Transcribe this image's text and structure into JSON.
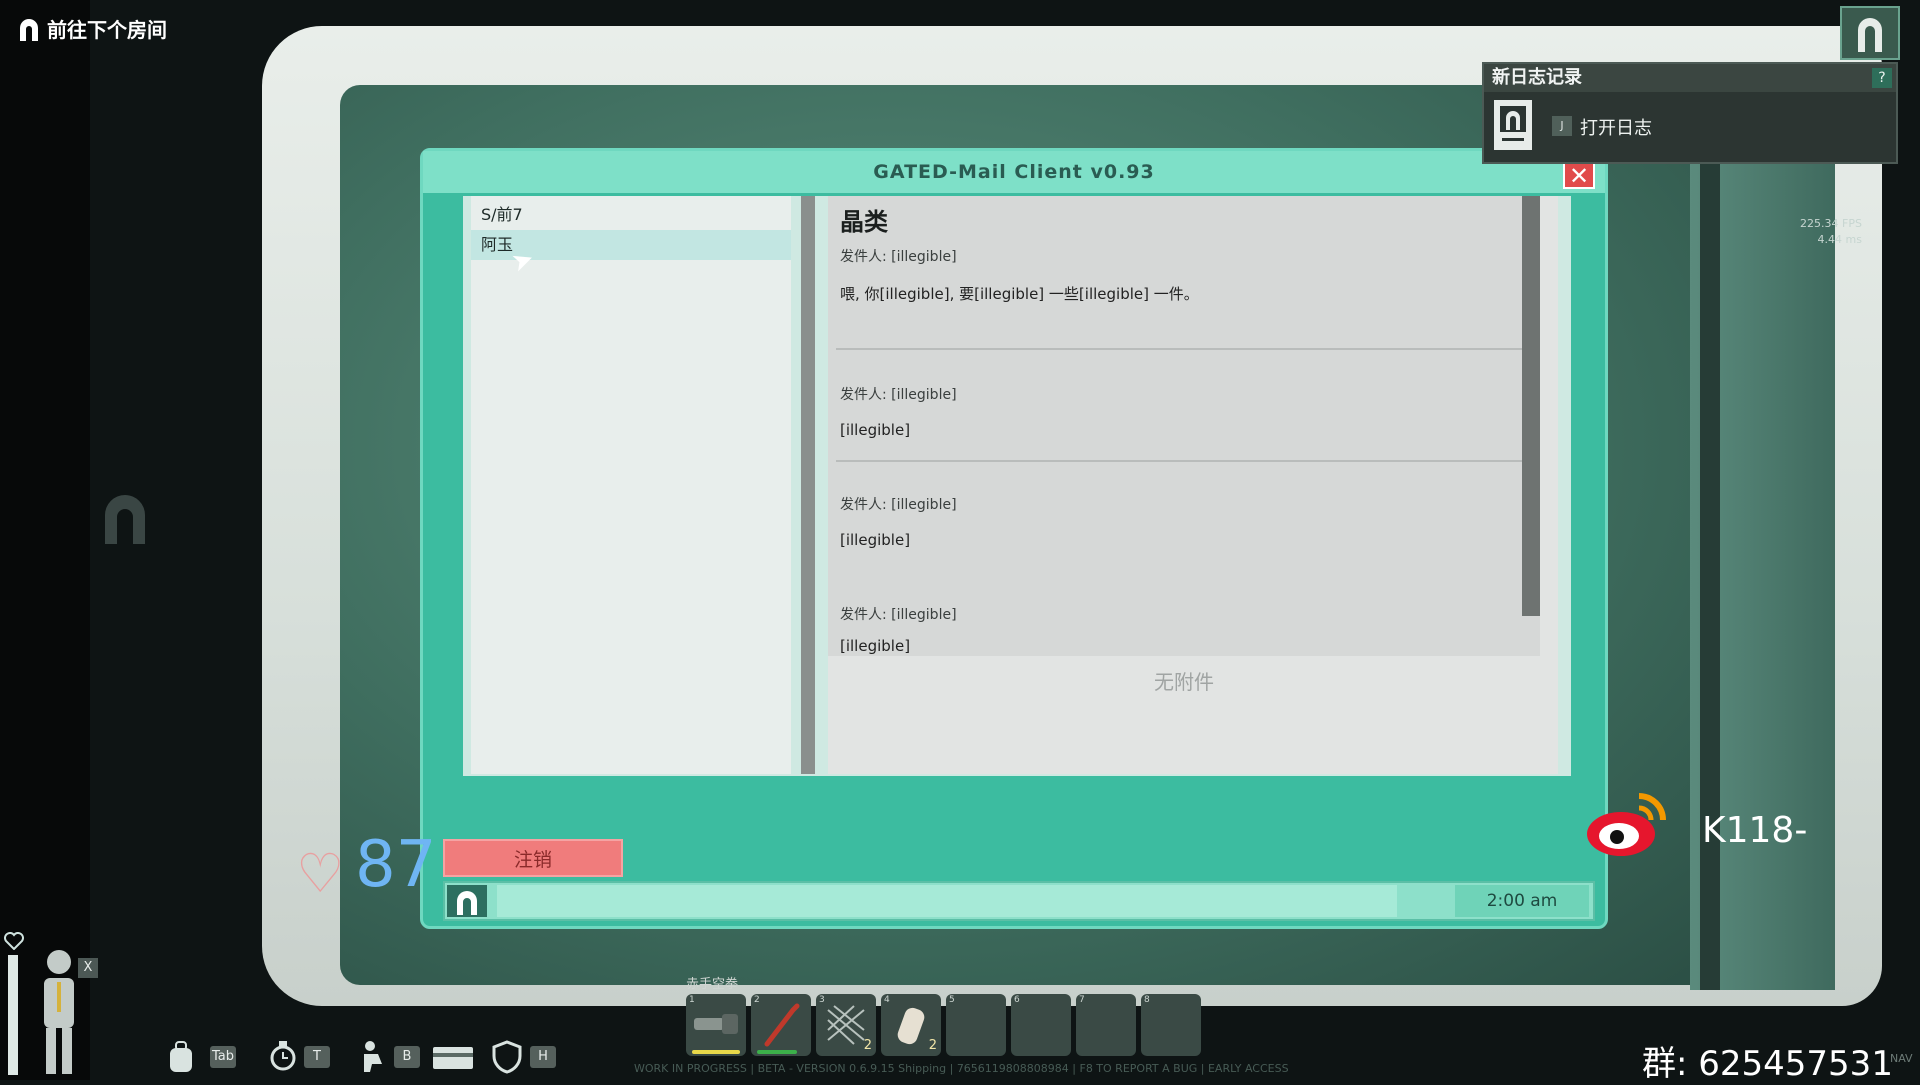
{
  "hud": {
    "objective": "前往下个房间",
    "health": "87",
    "fps_line1": "225.34 FPS",
    "fps_line2": "4.44 ms",
    "group_text": "群: 625457531",
    "k118": "K118-",
    "nav": "NAV",
    "wip": "WORK IN PROGRESS | BETA - VERSION 0.6.9.15 Shipping | 7656119808808984 | F8 TO REPORT A BUG | EARLY ACCESS",
    "keys": {
      "tab": "Tab",
      "t": "T",
      "b": "B",
      "h": "H",
      "x": "X"
    },
    "hotbar_label": "赤手空拳",
    "hotbar": [
      {
        "num": "1",
        "item": "flashlight",
        "count": "",
        "bar_color": "#e8d84a"
      },
      {
        "num": "2",
        "item": "crowbar",
        "count": "",
        "bar_color": "#3cb04a"
      },
      {
        "num": "3",
        "item": "net",
        "count": "2",
        "bar_color": ""
      },
      {
        "num": "4",
        "item": "canister",
        "count": "2",
        "bar_color": ""
      },
      {
        "num": "5",
        "item": "",
        "count": "",
        "bar_color": ""
      },
      {
        "num": "6",
        "item": "",
        "count": "",
        "bar_color": ""
      },
      {
        "num": "7",
        "item": "",
        "count": "",
        "bar_color": ""
      },
      {
        "num": "8",
        "item": "",
        "count": "",
        "bar_color": ""
      }
    ]
  },
  "log_panel": {
    "title": "新日志记录",
    "help": "?",
    "key": "J",
    "open_label": "打开日志"
  },
  "terminal": {
    "title": "GATED-Mail Client v0.93",
    "close": "✕",
    "list": [
      "S/前7",
      "阿玉"
    ],
    "message_title": "晶类",
    "messages": [
      {
        "from": "发件人: [illegible]",
        "body": "喂, 你[illegible], 要[illegible] 一些[illegible] 一件。"
      },
      {
        "from": "发件人: [illegible]",
        "body": "[illegible]"
      },
      {
        "from": "发件人: [illegible]",
        "body": "[illegible]"
      },
      {
        "from": "发件人: [illegible]",
        "body": "[illegible]"
      }
    ],
    "attachment": "无附件",
    "logout": "注销",
    "time": "2:00 am"
  },
  "colors": {
    "terminal_bg": "#3cbca0",
    "logout_bg": "#f07c7c",
    "close_bg": "#e14b4b",
    "health_text": "#6fb5f3"
  }
}
